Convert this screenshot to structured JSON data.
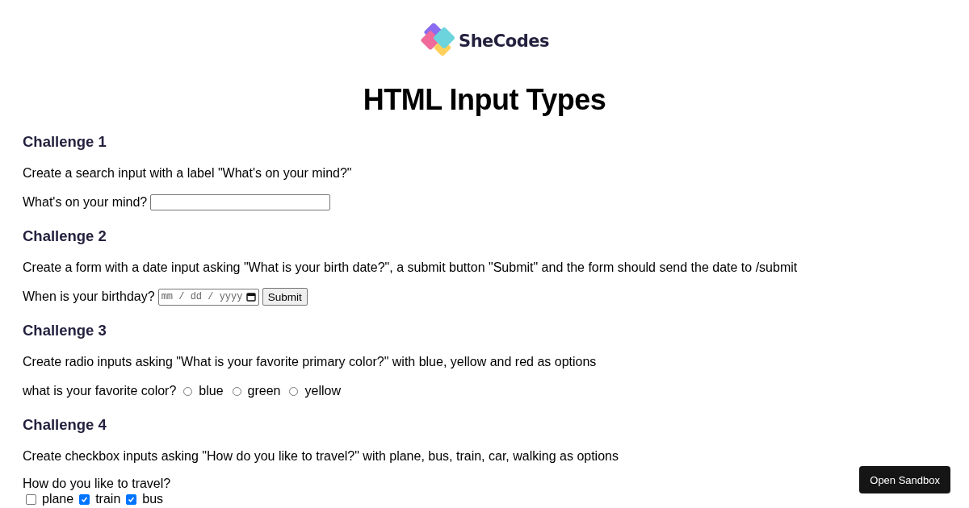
{
  "logo": {
    "text": "SheCodes"
  },
  "title": "HTML Input Types",
  "challenges": [
    {
      "heading": "Challenge 1",
      "task": "Create a search input with a label \"What's on your mind?\"",
      "kind": "search",
      "label": "What's on your mind?"
    },
    {
      "heading": "Challenge 2",
      "task": "Create a form with a date input asking \"What is your birth date?\", a submit button \"Submit\" and the form should send the date to /submit",
      "kind": "date",
      "label": "When is your birthday?",
      "placeholder": "mm / dd / yyyy",
      "button": "Submit"
    },
    {
      "heading": "Challenge 3",
      "task": "Create radio inputs asking \"What is your favorite primary color?\" with blue, yellow and red as options",
      "kind": "radio",
      "label": "what is your favorite color?",
      "options": [
        {
          "label": "blue",
          "selected": false
        },
        {
          "label": "green",
          "selected": false
        },
        {
          "label": "yellow",
          "selected": false
        }
      ]
    },
    {
      "heading": "Challenge 4",
      "task": "Create checkbox inputs asking \"How do you like to travel?\" with plane, bus, train, car, walking as options",
      "kind": "checkbox",
      "label": "How do you like to travel?",
      "options": [
        {
          "label": "plane",
          "checked": false
        },
        {
          "label": "train",
          "checked": true
        },
        {
          "label": "bus",
          "checked": true
        }
      ]
    }
  ],
  "sandbox_button": "Open Sandbox"
}
